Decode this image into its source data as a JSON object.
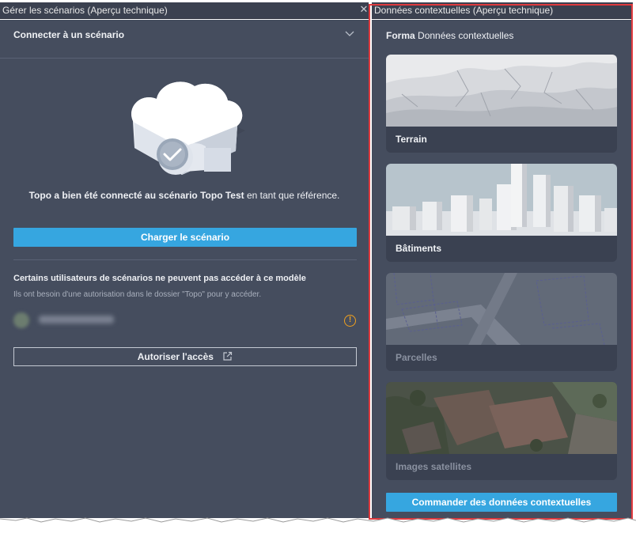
{
  "left_window": {
    "title": "Gérer les scénarios (Aperçu technique)",
    "close_glyph": "✕",
    "section_title": "Connecter à un scénario",
    "connected_message": {
      "prefix": "Topo a bien été connecté au scénario ",
      "scenario_name": "Topo Test",
      "suffix": " en tant que référence."
    },
    "load_button": "Charger le scénario",
    "warning_title": "Certains utilisateurs de scénarios ne peuvent pas accéder à ce modèle",
    "warning_subtitle": "Ils ont besoin d'une autorisation dans le dossier \"Topo\" pour y accéder.",
    "warning_icon_glyph": "!",
    "authorize_button": "Autoriser l'accès"
  },
  "right_window": {
    "title": "Données contextuelles (Aperçu technique)",
    "heading_brand": "Forma",
    "heading_text": " Données contextuelles",
    "cards": [
      {
        "label": "Terrain",
        "icon": "terrain-thumbnail",
        "enabled": true
      },
      {
        "label": "Bâtiments",
        "icon": "buildings-thumbnail",
        "enabled": true
      },
      {
        "label": "Parcelles",
        "icon": "parcels-thumbnail",
        "enabled": false
      },
      {
        "label": "Images satellites",
        "icon": "satellite-thumbnail",
        "enabled": false
      }
    ],
    "order_button": "Commander des données contextuelles"
  },
  "colors": {
    "panel_bg": "#454d5e",
    "titlebar_bg": "#3b4150",
    "accent_blue": "#36a6e0",
    "highlight_red": "#e03a3e",
    "warning_orange": "#f0a11f"
  }
}
